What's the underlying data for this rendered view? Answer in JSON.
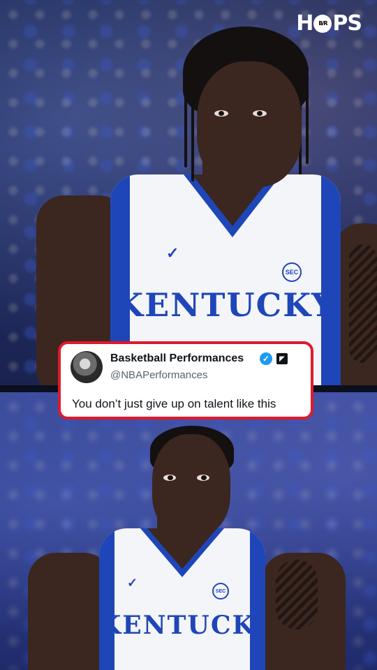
{
  "logo": {
    "text_left": "H",
    "ball_text": "B/R",
    "text_right": "PS"
  },
  "tweet": {
    "display_name": "Basketball Performances",
    "handle": "@NBAPerformances",
    "text": "You don’t just give up on talent like this",
    "verified_icon": "verified-check-icon",
    "badge_icon": "affiliate-badge-icon",
    "border_color": "#e0192b",
    "verified_color": "#1d9bf0"
  },
  "top_player": {
    "jersey_text": "KENTUCKY",
    "patch": "SEC"
  },
  "bottom_player": {
    "jersey_text": "KENTUCKY",
    "patch": "SEC"
  },
  "colors": {
    "jersey_blue": "#1f46b8",
    "jersey_white": "#f4f5f8"
  }
}
